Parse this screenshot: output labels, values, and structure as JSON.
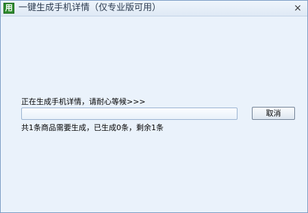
{
  "window": {
    "title": "一键生成手机详情（仅专业版可用）",
    "icon_glyph": "用",
    "icon_name": "app-icon",
    "close_glyph": "×"
  },
  "status": {
    "message": "正在生成手机详情，请耐心等候>>>"
  },
  "progress": {
    "fraction": 0
  },
  "buttons": {
    "cancel_label": "取消"
  },
  "summary": {
    "text": "共1条商品需要生成，已生成0条，剩余1条"
  },
  "colors": {
    "titlebar": "#dfe9f5",
    "body": "#eaf2fb",
    "accent": "#69a7e6"
  }
}
